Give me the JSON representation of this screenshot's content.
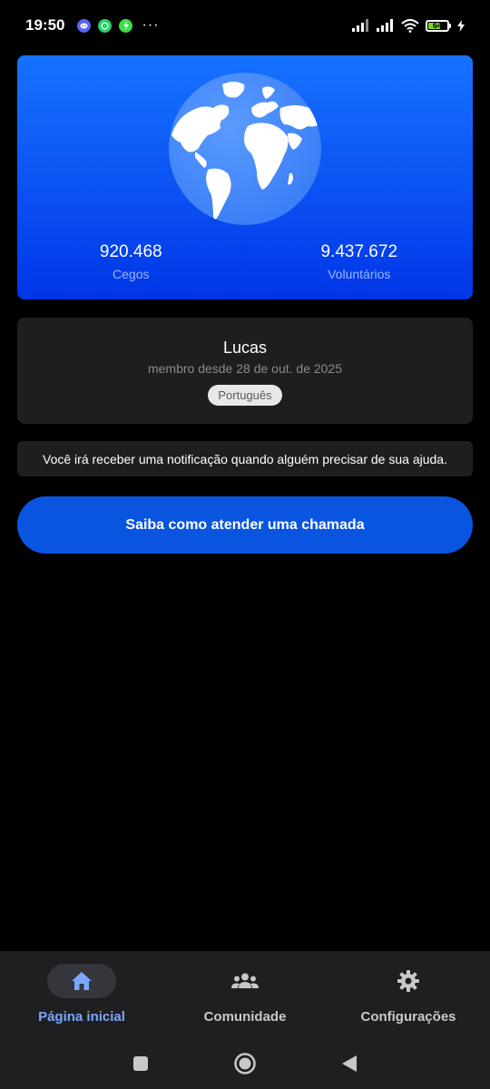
{
  "status_bar": {
    "time": "19:50",
    "battery_level": "64",
    "battery_percent": 0.64,
    "icons": [
      "discord-icon",
      "whatsapp-icon",
      "bolt-app-icon",
      "more-dots-icon",
      "signal-icon",
      "signal-icon",
      "wifi-icon",
      "battery-icon",
      "charging-icon"
    ],
    "more": "···"
  },
  "colors": {
    "hero_gradient_top": "#1672ff",
    "hero_gradient_bottom": "#0035e6",
    "card_bg": "#1e1e20",
    "cta_bg": "#0a55e0",
    "nav_active": "#7aa7ff",
    "battery_green": "#7ed321"
  },
  "hero": {
    "globe_icon": "globe-icon",
    "stats": [
      {
        "value": "920.468",
        "label": "Cegos"
      },
      {
        "value": "9.437.672",
        "label": "Voluntários"
      }
    ]
  },
  "profile": {
    "name": "Lucas",
    "member_since": "membro desde 28 de out. de 2025",
    "language": "Português"
  },
  "info_banner": "Você irá receber uma notificação quando alguém precisar de sua ajuda.",
  "cta_label": "Saiba como atender uma chamada",
  "bottom_nav": {
    "items": [
      {
        "label": "Página inicial",
        "icon": "home-icon",
        "active": true
      },
      {
        "label": "Comunidade",
        "icon": "community-icon",
        "active": false
      },
      {
        "label": "Configurações",
        "icon": "gear-icon",
        "active": false
      }
    ]
  },
  "system_nav": [
    "recents-button",
    "home-button",
    "back-button"
  ]
}
